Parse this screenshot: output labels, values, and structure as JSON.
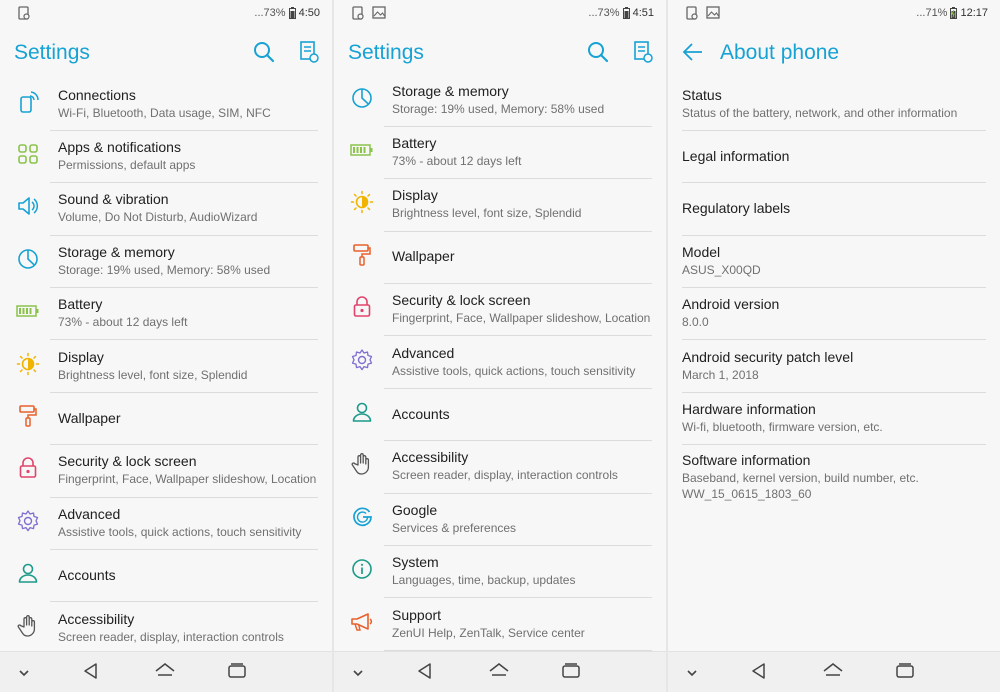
{
  "colors": {
    "accent": "#17a2d4",
    "connections": "#17a2d4",
    "apps": "#8bc34a",
    "sound": "#17a2d4",
    "storage": "#17a2d4",
    "battery": "#8bc34a",
    "display": "#f0b400",
    "wallpaper": "#e8612c",
    "security": "#e0446b",
    "advanced": "#7c6fd1",
    "accounts": "#1c9a8a",
    "accessibility": "#555555",
    "google": "#17a2d4",
    "system": "#1c9a8a",
    "support": "#e8612c"
  },
  "screen1": {
    "status": {
      "battery": "...73%",
      "time": "4:50"
    },
    "title": "Settings",
    "items": [
      {
        "title": "Connections",
        "sub": "Wi-Fi, Bluetooth, Data usage, SIM, NFC",
        "icon": "connections-icon"
      },
      {
        "title": "Apps & notifications",
        "sub": "Permissions, default apps",
        "icon": "apps-grid-icon"
      },
      {
        "title": "Sound & vibration",
        "sub": "Volume, Do Not Disturb, AudioWizard",
        "icon": "speaker-icon"
      },
      {
        "title": "Storage & memory",
        "sub": "Storage: 19% used, Memory: 58% used",
        "icon": "storage-pie-icon"
      },
      {
        "title": "Battery",
        "sub": "73% - about 12 days left",
        "icon": "battery-icon"
      },
      {
        "title": "Display",
        "sub": "Brightness level, font size, Splendid",
        "icon": "brightness-icon"
      },
      {
        "title": "Wallpaper",
        "sub": "",
        "icon": "paint-roller-icon"
      },
      {
        "title": "Security & lock screen",
        "sub": "Fingerprint, Face, Wallpaper slideshow, Location",
        "icon": "lock-icon"
      },
      {
        "title": "Advanced",
        "sub": "Assistive tools, quick actions, touch sensitivity",
        "icon": "gear-icon"
      },
      {
        "title": "Accounts",
        "sub": "",
        "icon": "person-icon"
      },
      {
        "title": "Accessibility",
        "sub": "Screen reader, display, interaction controls",
        "icon": "hand-icon"
      }
    ]
  },
  "screen2": {
    "status": {
      "battery": "...73%",
      "time": "4:51"
    },
    "title": "Settings",
    "items": [
      {
        "title": "Storage & memory",
        "sub": "Storage: 19% used, Memory: 58% used",
        "icon": "storage-pie-icon"
      },
      {
        "title": "Battery",
        "sub": "73% - about 12 days left",
        "icon": "battery-icon"
      },
      {
        "title": "Display",
        "sub": "Brightness level, font size, Splendid",
        "icon": "brightness-icon"
      },
      {
        "title": "Wallpaper",
        "sub": "",
        "icon": "paint-roller-icon"
      },
      {
        "title": "Security & lock screen",
        "sub": "Fingerprint, Face, Wallpaper slideshow, Location",
        "icon": "lock-icon"
      },
      {
        "title": "Advanced",
        "sub": "Assistive tools, quick actions, touch sensitivity",
        "icon": "gear-icon"
      },
      {
        "title": "Accounts",
        "sub": "",
        "icon": "person-icon"
      },
      {
        "title": "Accessibility",
        "sub": "Screen reader, display, interaction controls",
        "icon": "hand-icon"
      },
      {
        "title": "Google",
        "sub": "Services & preferences",
        "icon": "google-icon"
      },
      {
        "title": "System",
        "sub": "Languages, time, backup, updates",
        "icon": "info-icon"
      },
      {
        "title": "Support",
        "sub": "ZenUI Help, ZenTalk, Service center",
        "icon": "megaphone-icon"
      }
    ]
  },
  "screen3": {
    "status": {
      "battery": "...71%",
      "time": "12:17"
    },
    "title": "About phone",
    "items": [
      {
        "title": "Status",
        "sub": "Status of the battery, network, and other information"
      },
      {
        "title": "Legal information",
        "sub": ""
      },
      {
        "title": "Regulatory labels",
        "sub": ""
      },
      {
        "title": "Model",
        "sub": "ASUS_X00QD"
      },
      {
        "title": "Android version",
        "sub": "8.0.0"
      },
      {
        "title": "Android security patch level",
        "sub": "March 1, 2018"
      },
      {
        "title": "Hardware information",
        "sub": "Wi-fi, bluetooth, firmware version, etc."
      },
      {
        "title": "Software information",
        "sub": "Baseband, kernel version, build number, etc.",
        "sub2": "WW_15_0615_1803_60"
      }
    ]
  }
}
